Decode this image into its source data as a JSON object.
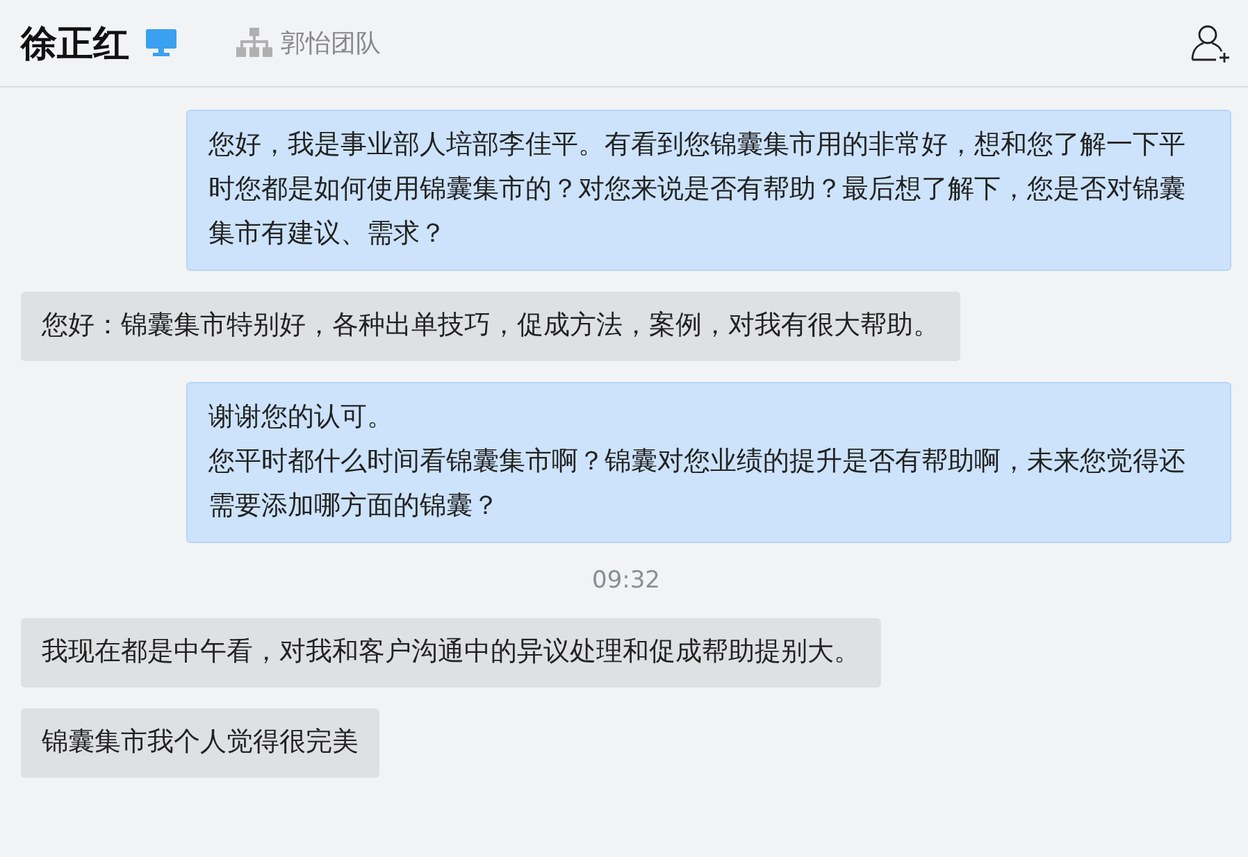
{
  "header": {
    "contact_name": "徐正红",
    "team": "郭怡团队"
  },
  "messages": [
    {
      "kind": "sent",
      "paragraphs": [
        "您好，我是事业部人培部李佳平。有看到您锦囊集市用的非常好，想和您了解一下平时您都是如何使用锦囊集市的？对您来说是否有帮助？最后想了解下，您是否对锦囊集市有建议、需求？"
      ]
    },
    {
      "kind": "received",
      "paragraphs": [
        "您好：锦囊集市特别好，各种出单技巧，促成方法，案例，对我有很大帮助。"
      ]
    },
    {
      "kind": "sent",
      "paragraphs": [
        "谢谢您的认可。",
        "您平时都什么时间看锦囊集市啊？锦囊对您业绩的提升是否有帮助啊，未来您觉得还需要添加哪方面的锦囊？"
      ]
    },
    {
      "kind": "time",
      "paragraphs": [
        "09:32"
      ]
    },
    {
      "kind": "received",
      "paragraphs": [
        "我现在都是中午看，对我和客户沟通中的异议处理和促成帮助提别大。"
      ]
    },
    {
      "kind": "received",
      "paragraphs": [
        "锦囊集市我个人觉得很完美"
      ]
    }
  ]
}
